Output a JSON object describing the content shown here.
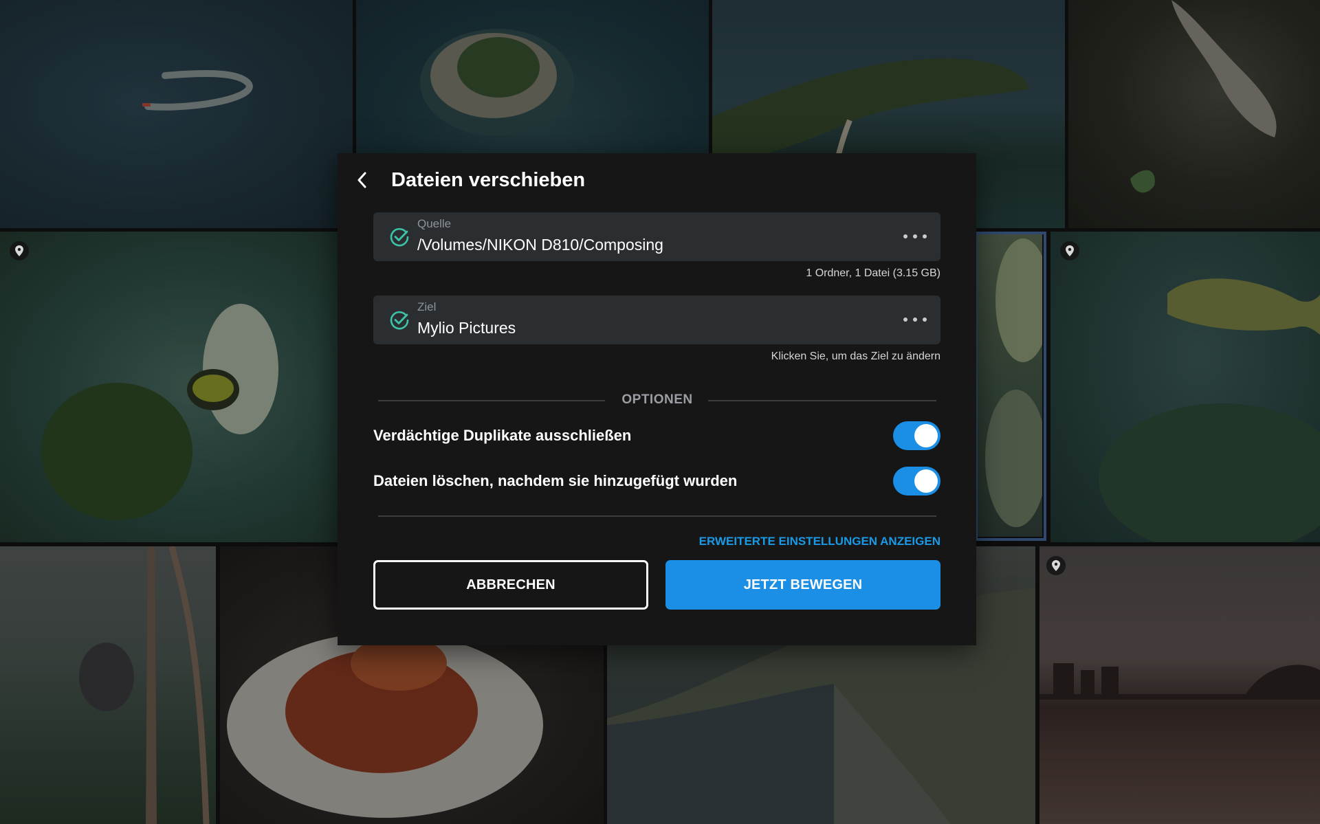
{
  "dialog": {
    "title": "Dateien verschieben",
    "back_icon": "chevron-left-icon"
  },
  "source": {
    "label": "Quelle",
    "path": "/Volumes/NIKON D810/Composing",
    "meta": "1 Ordner, 1 Datei (3.15 GB)",
    "status_icon": "check-circle-icon",
    "more_icon": "more-horizontal-icon"
  },
  "destination": {
    "label": "Ziel",
    "name": "Mylio Pictures",
    "hint": "Klicken Sie, um das Ziel zu ändern",
    "status_icon": "check-circle-icon",
    "more_icon": "more-horizontal-icon"
  },
  "options": {
    "heading": "OPTIONEN",
    "items": [
      {
        "label": "Verdächtige Duplikate ausschließen",
        "enabled": true
      },
      {
        "label": "Dateien löschen, nachdem sie hinzugefügt wurden",
        "enabled": true
      }
    ]
  },
  "advanced_link": "ERWEITERTE EINSTELLUNGEN ANZEIGEN",
  "buttons": {
    "cancel": "ABBRECHEN",
    "confirm": "JETZT BEWEGEN"
  },
  "colors": {
    "accent": "#1a8fe5",
    "link": "#1a9ae6",
    "check": "#3cc3a8",
    "dialog_bg": "#161616",
    "card_bg": "#2b2e31"
  },
  "background": {
    "photo_grid": [
      "boat-wake",
      "island",
      "coastline",
      "bird",
      "sea-sponge",
      "coral",
      "fish",
      "koala",
      "lobster-dish",
      "aerial-harbor",
      "city-sunset"
    ],
    "pin_icon": "location-pin-icon"
  }
}
